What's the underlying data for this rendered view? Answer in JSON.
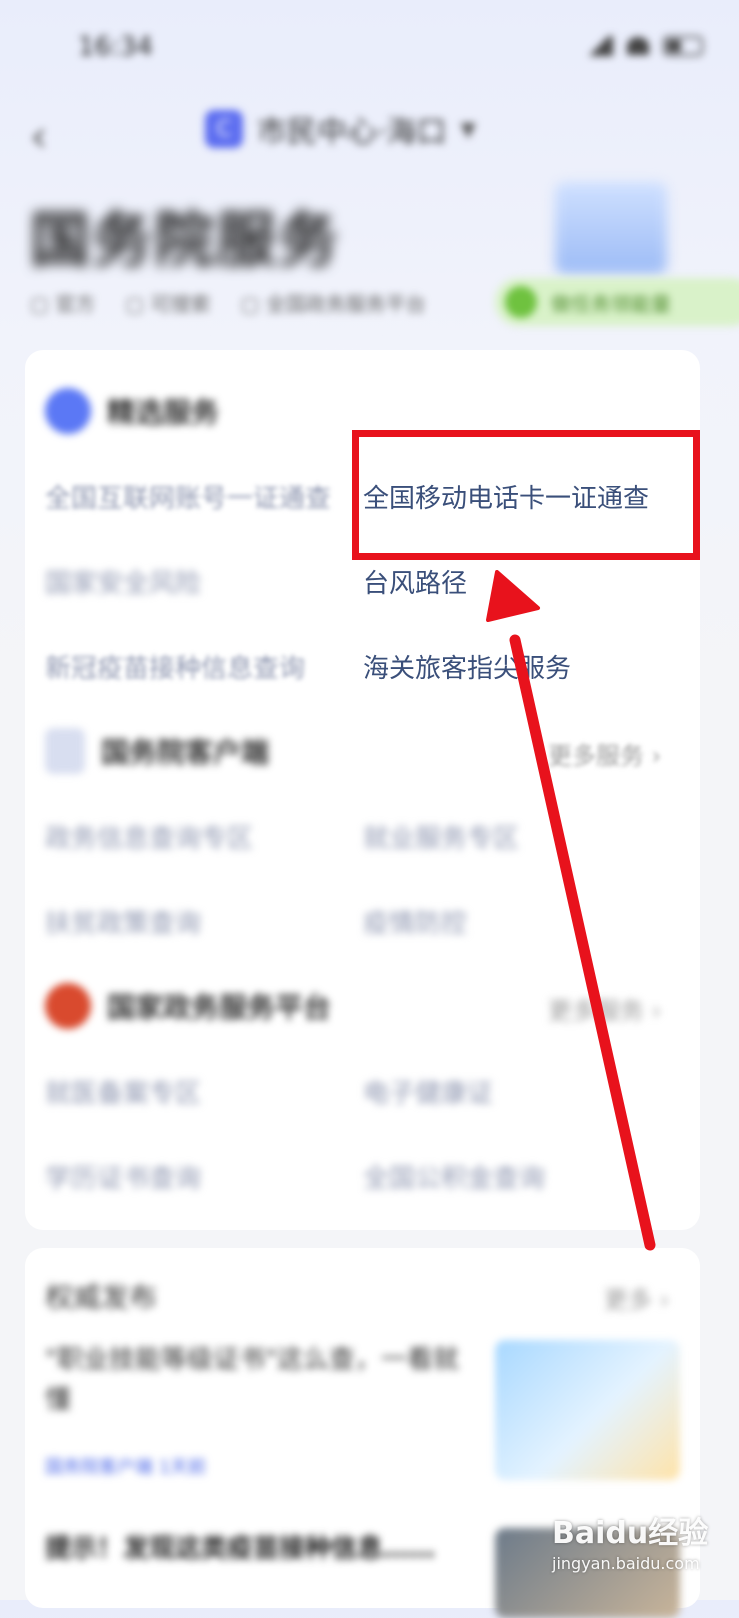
{
  "status_bar": {
    "time": "16:34"
  },
  "nav": {
    "title": "市民中心·海口",
    "logo_glyph": "C"
  },
  "header": {
    "title": "国务院服务",
    "meta": [
      "官方",
      "可搜索",
      "全国政务服务平台"
    ],
    "badge": "做任务领能量"
  },
  "featured": {
    "title": "精选服务",
    "left_items": [
      "全国互联网账号一证通查",
      "国家安全风险",
      "新冠疫苗接种信息查询"
    ],
    "right_items": [
      "全国移动电话卡一证通查",
      "台风路径",
      "海关旅客指尖服务"
    ]
  },
  "client": {
    "title": "国务院客户端",
    "more": "更多服务",
    "items": [
      "政务信息查询专区",
      "就业服务专区",
      "扶贫政策查询",
      "疫情防控"
    ]
  },
  "platform": {
    "title": "国家政务服务平台",
    "more": "更多服务",
    "items": [
      "就医备案专区",
      "电子健康证",
      "学历证书查询",
      "全国公积金查询"
    ]
  },
  "news": {
    "title": "权威发布",
    "more": "更多",
    "headline": "\"职业技能等级证书\"这么查，一看就懂",
    "meta": "国务院客户端  1天前",
    "headline2": "提示！发现这类疫苗接种信息……"
  },
  "watermark": {
    "logo": "Baidu经验",
    "url": "jingyan.baidu.com"
  },
  "colors": {
    "annotation": "#e8121c",
    "link": "#3a4f7a"
  }
}
